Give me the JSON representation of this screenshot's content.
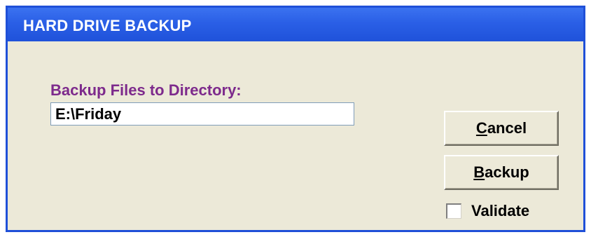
{
  "window": {
    "title": "HARD DRIVE BACKUP",
    "titlebar_color": "#2a5fe6",
    "background_color": "#ece9d8"
  },
  "form": {
    "directory_label": "Backup Files to Directory:",
    "directory_label_color": "#7d2a8c",
    "directory_value": "E:\\Friday"
  },
  "buttons": {
    "cancel": {
      "mnemonic": "C",
      "rest": "ancel"
    },
    "backup": {
      "mnemonic": "B",
      "rest": "ackup"
    }
  },
  "options": {
    "validate_label": "Validate",
    "validate_checked": false
  }
}
